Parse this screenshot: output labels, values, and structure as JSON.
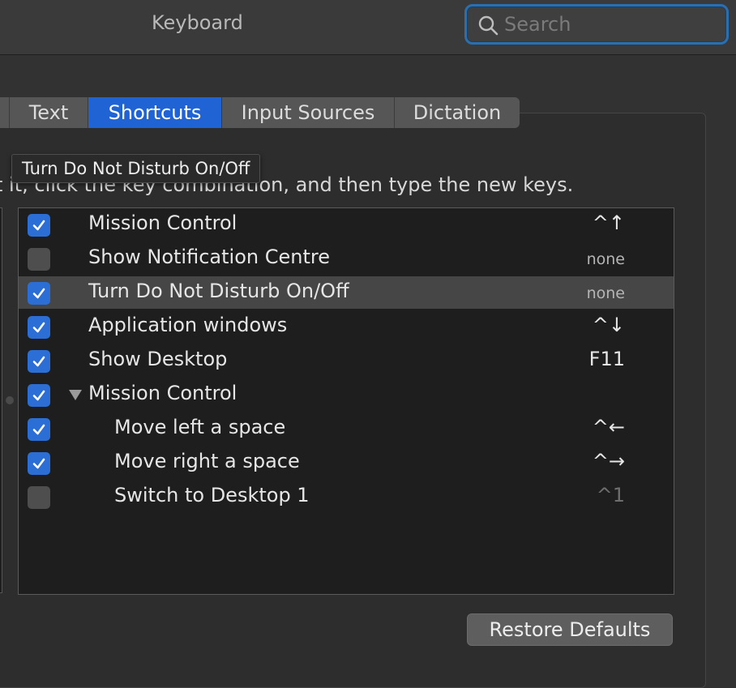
{
  "window": {
    "title": "Keyboard"
  },
  "search": {
    "placeholder": "Search"
  },
  "tabs": [
    {
      "label": ""
    },
    {
      "label": "Text"
    },
    {
      "label": "Shortcuts"
    },
    {
      "label": "Input Sources"
    },
    {
      "label": "Dictation"
    }
  ],
  "instruction": "t it, click the key combination, and then type the new keys.",
  "tooltip": "Turn Do Not Disturb On/Off",
  "shortcuts": [
    {
      "label": "Mission Control",
      "key": "^↑",
      "checked": true
    },
    {
      "label": "Show Notification Centre",
      "key": "none",
      "checked": false
    },
    {
      "label": "Turn Do Not Disturb On/Off",
      "key": "none",
      "checked": true
    },
    {
      "label": "Application windows",
      "key": "^↓",
      "checked": true
    },
    {
      "label": "Show Desktop",
      "key": "F11",
      "checked": true
    },
    {
      "label": "Mission Control",
      "key": "",
      "checked": true
    },
    {
      "label": "Move left a space",
      "key": "^←",
      "checked": true
    },
    {
      "label": "Move right a space",
      "key": "^→",
      "checked": true
    },
    {
      "label": "Switch to Desktop 1",
      "key": "^1",
      "checked": false
    }
  ],
  "buttons": {
    "restore_defaults": "Restore Defaults"
  },
  "colors": {
    "accent": "#1f63d4",
    "checkbox_on": "#2b6fd6",
    "focus_ring": "#2a6fb0"
  }
}
